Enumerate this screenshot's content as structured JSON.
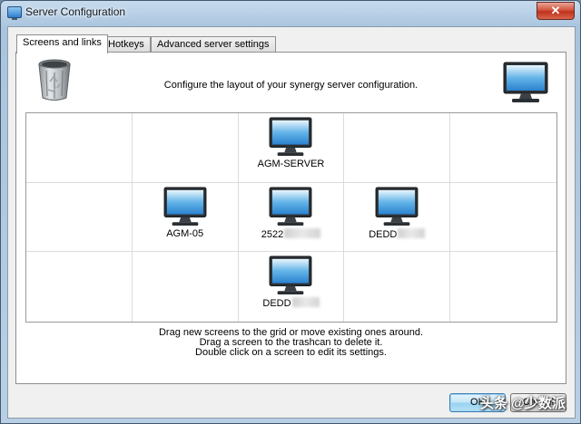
{
  "window": {
    "title": "Server Configuration",
    "close_label": "✕"
  },
  "tabs": [
    {
      "label": "Screens and links",
      "active": true
    },
    {
      "label": "Hotkeys",
      "active": false
    },
    {
      "label": "Advanced server settings",
      "active": false
    }
  ],
  "panel": {
    "header_text": "Configure the layout of your synergy server configuration.",
    "trash_icon": "trashcan-icon",
    "new_screen_icon": "monitor-icon"
  },
  "screens": {
    "server": {
      "label": "AGM-SERVER"
    },
    "agm05": {
      "label": "AGM-05"
    },
    "s2522": {
      "label": "2522"
    },
    "dedd_right": {
      "label": "DEDD"
    },
    "dedd_bottom": {
      "label": "DEDD"
    }
  },
  "help": {
    "line1": "Drag new screens to the grid or move existing ones around.",
    "line2": "Drag a screen to the trashcan to delete it.",
    "line3": "Double click on a screen to edit its settings."
  },
  "buttons": {
    "ok": "OK",
    "cancel": "Cancel"
  },
  "watermark": "头条 @少数派"
}
